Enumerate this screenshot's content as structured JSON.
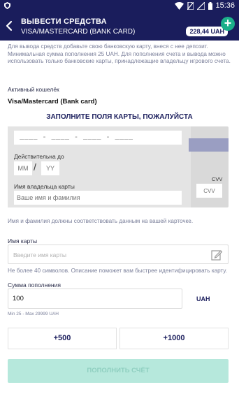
{
  "status_bar": {
    "time": "15:36",
    "icons": [
      "shield-icon",
      "wifi-icon",
      "no-sim-icon",
      "signal-icon",
      "battery-icon"
    ]
  },
  "header": {
    "title": "ВЫВЕСТИ СРЕДСТВА",
    "subtitle": "VISA/MASTERCARD (BANK CARD)",
    "balance": "228,44 UAH",
    "plus": "+"
  },
  "info_text": "Для вывода средств добавьте свою банковскую карту, внеся с нее депозит. Минимальная сумма пополнения 25 UAH. Для пополнения счета и вывода можно использовать только банковские карты, принадлежащие владельцу игрового счета.",
  "wallet": {
    "label": "Активный кошелёк",
    "value": "Visa/Mastercard (Bank card)"
  },
  "form_title": "ЗАПОЛНИТЕ ПОЛЯ КАРТЫ, ПОЖАЛУЙСТА",
  "card": {
    "number_placeholder": "____ - ____ - ____ - ____",
    "valid_label": "Действительна до",
    "month_placeholder": "MM",
    "slash": "/",
    "year_placeholder": "YY",
    "holder_label": "Имя владельца карты",
    "holder_placeholder": "Ваше имя и фамилия",
    "cvv_label": "CVV",
    "cvv_placeholder": "CVV"
  },
  "name_hint": "Имя и фамилия должны соответствовать данным на вашей карточке.",
  "card_name": {
    "label": "Имя карты",
    "placeholder": "Введите имя карты",
    "hint": "Не более 40 символов. Описание поможет вам быстрее идентифицировать карту."
  },
  "amount": {
    "label": "Сумма пополнения",
    "value": "100",
    "currency": "UAH",
    "limits": "Min 25 - Max 29999 UAH"
  },
  "quick_amounts": [
    "+500",
    "+1000"
  ],
  "submit_label": "ПОПОЛНИТЬ СЧЁТ",
  "colors": {
    "header_bg": "#1a1d5c",
    "accent_green": "#1bb08a",
    "submit_bg": "#b6e8dc"
  }
}
